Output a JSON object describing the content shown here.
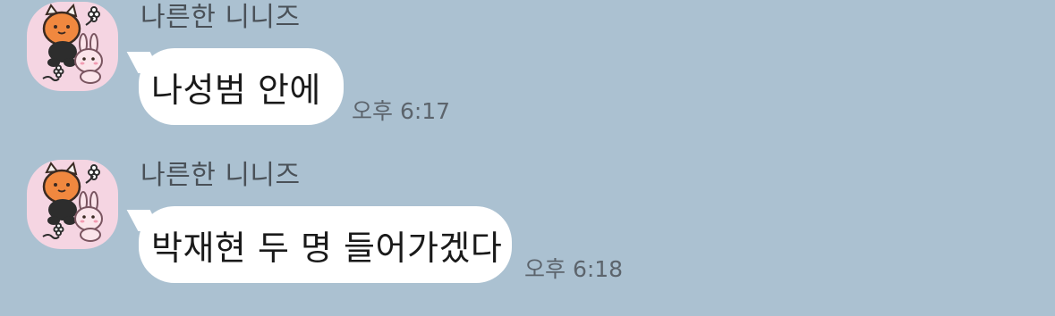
{
  "colors": {
    "background": "#abc1d1",
    "bubble": "#ffffff",
    "avatar_bg": "#f5d5e2"
  },
  "messages": [
    {
      "sender": "나른한 니니즈",
      "avatar_icon": "bear-and-bunny-avatar-icon",
      "text": "나성범 안에",
      "time": "오후 6:17"
    },
    {
      "sender": "나른한 니니즈",
      "avatar_icon": "bear-and-bunny-avatar-icon",
      "text": "박재현 두 명 들어가겠다",
      "time": "오후 6:18"
    }
  ]
}
